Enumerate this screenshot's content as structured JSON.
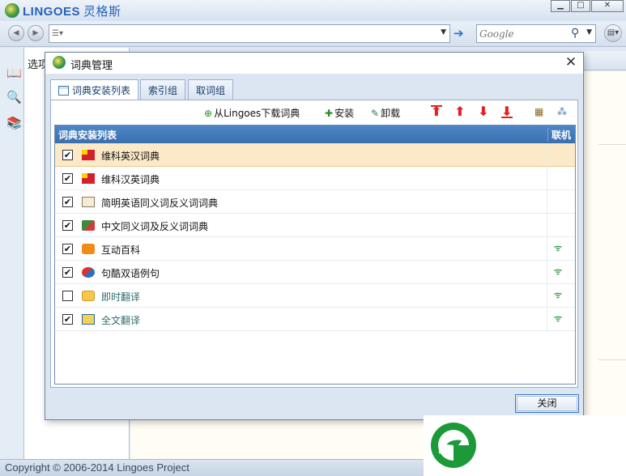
{
  "app": {
    "name": "LINGOES",
    "name_cn": "灵格斯",
    "copyright": "Copyright © 2006-2014 Lingoes Project"
  },
  "toolbar": {
    "search_value": "",
    "google_placeholder": "Google"
  },
  "sidebar": {
    "options_label": "选项"
  },
  "dialog": {
    "title": "词典管理",
    "tabs": [
      {
        "label": "词典安装列表",
        "active": true
      },
      {
        "label": "索引组",
        "active": false
      },
      {
        "label": "取词组",
        "active": false
      }
    ],
    "actions": {
      "download_label": "从Lingoes下载词典",
      "install_label": "安装",
      "uninstall_label": "卸载"
    },
    "list": {
      "header_name": "词典安装列表",
      "header_online": "联机",
      "items": [
        {
          "name": "维科英汉词典",
          "checked": true,
          "online": false,
          "icon": "flag-en-cn-icon",
          "selected": true
        },
        {
          "name": "维科汉英词典",
          "checked": true,
          "online": false,
          "icon": "flag-cn-en-icon",
          "selected": false
        },
        {
          "name": "简明英语同义词反义词词典",
          "checked": true,
          "online": false,
          "icon": "book-icon",
          "selected": false
        },
        {
          "name": "中文同义词及反义词词典",
          "checked": true,
          "online": false,
          "icon": "synonym-icon",
          "selected": false
        },
        {
          "name": "互动百科",
          "checked": true,
          "online": true,
          "icon": "hudong-icon",
          "selected": false
        },
        {
          "name": "句酷双语例句",
          "checked": true,
          "online": true,
          "icon": "juku-icon",
          "selected": false
        },
        {
          "name": "即时翻译",
          "checked": false,
          "online": true,
          "icon": "instant-translate-icon",
          "selected": false
        },
        {
          "name": "全文翻译",
          "checked": true,
          "online": true,
          "icon": "full-translate-icon",
          "selected": false
        }
      ]
    },
    "close_label": "关闭"
  },
  "colors": {
    "accent": "#3a70b0",
    "selected_row": "#fbe9c8",
    "online_signal": "#3aa04a",
    "brand_green": "#1c9a3a"
  }
}
